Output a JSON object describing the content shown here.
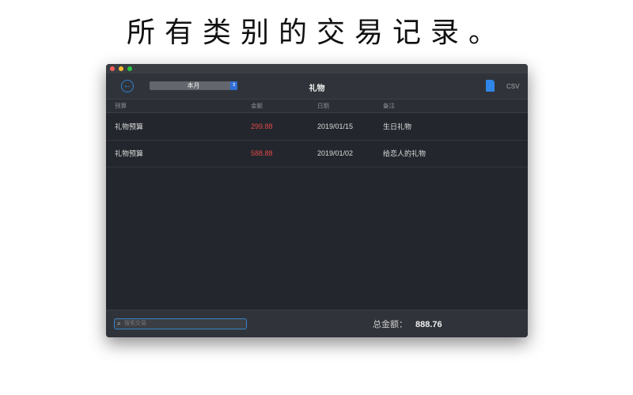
{
  "headline": "所有类别的交易记录。",
  "window": {
    "toolbar": {
      "period": "本月",
      "title": "礼物",
      "export_label": "CSV"
    },
    "columns": [
      "预算",
      "金额",
      "日期",
      "备注"
    ],
    "rows": [
      {
        "budget": "礼物预算",
        "amount": "299.88",
        "date": "2019/01/15",
        "note": "生日礼物"
      },
      {
        "budget": "礼物预算",
        "amount": "588.88",
        "date": "2019/01/02",
        "note": "给恋人的礼物"
      }
    ],
    "footer": {
      "search_placeholder": "搜索交易",
      "total_label": "总金额：",
      "total_value": "888.76"
    }
  },
  "colors": {
    "accent": "#2f86e8",
    "amount": "#e04a4a"
  }
}
